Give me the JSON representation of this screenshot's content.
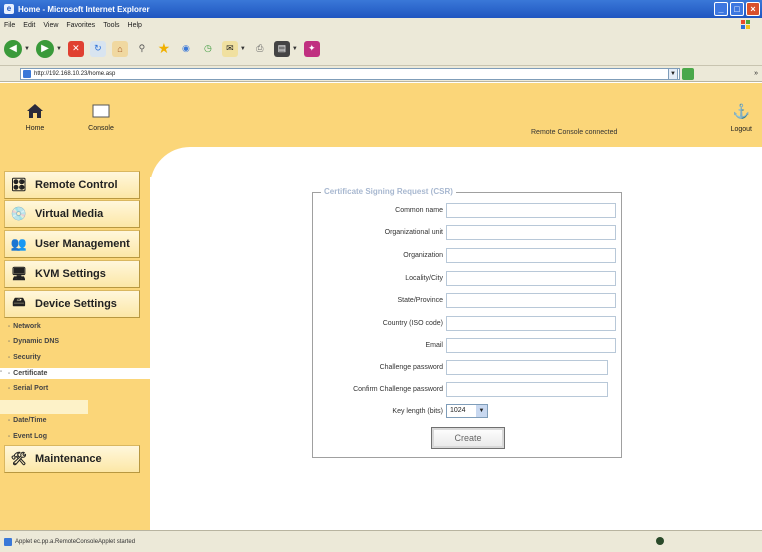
{
  "window": {
    "title": "Home - Microsoft Internet Explorer"
  },
  "menu": [
    "File",
    "Edit",
    "View",
    "Favorites",
    "Tools",
    "Help"
  ],
  "address": {
    "label": "Address",
    "url": "http://192.168.10.23/home.asp",
    "links": "»"
  },
  "header": {
    "home_label": "Home",
    "console_label": "Console",
    "status": "Remote Console connected",
    "logout_label": "Logout"
  },
  "sidebar": {
    "remote_control": "Remote Control",
    "virtual_media": "Virtual Media",
    "user_management": "User Management",
    "kvm_settings": "KVM Settings",
    "device_settings": "Device Settings",
    "sub": {
      "network": "Network",
      "dynamic_dns": "Dynamic DNS",
      "security": "Security",
      "certificate": "Certificate",
      "serial_port": "Serial Port",
      "date_time": "Date/Time",
      "event_log": "Event Log"
    },
    "maintenance": "Maintenance"
  },
  "form": {
    "legend": "Certificate Signing Request (CSR)",
    "fields": [
      {
        "label": "Common name",
        "value": ""
      },
      {
        "label": "Organizational unit",
        "value": ""
      },
      {
        "label": "Organization",
        "value": ""
      },
      {
        "label": "Locality/City",
        "value": ""
      },
      {
        "label": "State/Province",
        "value": ""
      },
      {
        "label": "Country (ISO code)",
        "value": ""
      },
      {
        "label": "Email",
        "value": ""
      },
      {
        "label": "Challenge password",
        "value": ""
      },
      {
        "label": "Confirm Challenge password",
        "value": ""
      }
    ],
    "key_length_label": "Key length (bits)",
    "key_length_value": "1024",
    "create_label": "Create"
  },
  "statusbar": {
    "text": "Applet ec.pp.a.RemoteConsoleApplet started"
  },
  "colors": {
    "header_bg": "#fbd679",
    "window_blue": "#1f55c0"
  }
}
